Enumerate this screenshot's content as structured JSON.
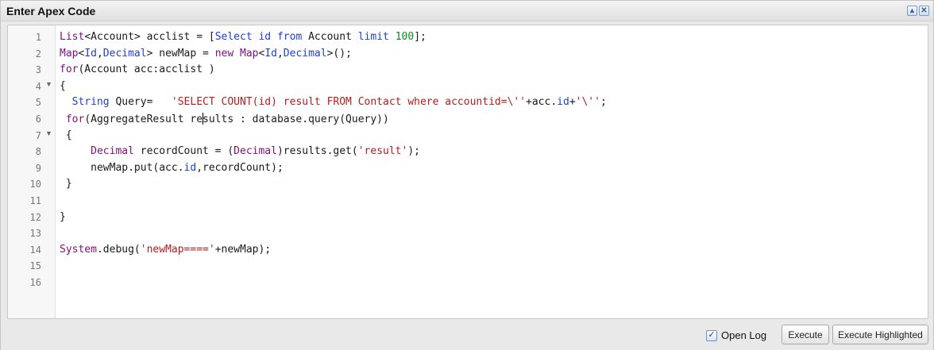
{
  "panel": {
    "title": "Enter Apex Code",
    "icons": {
      "collapse": "collapse-up-icon",
      "close": "close-icon"
    }
  },
  "editor": {
    "lines": [
      {
        "num": "1",
        "fold": "",
        "tokens": [
          {
            "t": "List",
            "k": "kw"
          },
          {
            "t": "<",
            "k": "plain"
          },
          {
            "t": "Account",
            "k": "plain"
          },
          {
            "t": "> acclist = [",
            "k": "plain"
          },
          {
            "t": "Select",
            "k": "type"
          },
          {
            "t": " ",
            "k": "plain"
          },
          {
            "t": "id",
            "k": "type"
          },
          {
            "t": " ",
            "k": "plain"
          },
          {
            "t": "from",
            "k": "type"
          },
          {
            "t": " Account ",
            "k": "plain"
          },
          {
            "t": "limit",
            "k": "type"
          },
          {
            "t": " ",
            "k": "plain"
          },
          {
            "t": "100",
            "k": "num"
          },
          {
            "t": "];",
            "k": "plain"
          }
        ]
      },
      {
        "num": "2",
        "fold": "",
        "tokens": [
          {
            "t": "Map",
            "k": "kw"
          },
          {
            "t": "<",
            "k": "plain"
          },
          {
            "t": "Id",
            "k": "type"
          },
          {
            "t": ",",
            "k": "plain"
          },
          {
            "t": "Decimal",
            "k": "type"
          },
          {
            "t": "> newMap = ",
            "k": "plain"
          },
          {
            "t": "new",
            "k": "kw"
          },
          {
            "t": " ",
            "k": "plain"
          },
          {
            "t": "Map",
            "k": "kw"
          },
          {
            "t": "<",
            "k": "plain"
          },
          {
            "t": "Id",
            "k": "type"
          },
          {
            "t": ",",
            "k": "plain"
          },
          {
            "t": "Decimal",
            "k": "type"
          },
          {
            "t": ">();",
            "k": "plain"
          }
        ]
      },
      {
        "num": "3",
        "fold": "",
        "tokens": [
          {
            "t": "for",
            "k": "kw"
          },
          {
            "t": "(Account acc:acclist )",
            "k": "plain"
          }
        ]
      },
      {
        "num": "4",
        "fold": "▼",
        "tokens": [
          {
            "t": "{",
            "k": "plain"
          }
        ]
      },
      {
        "num": "5",
        "fold": "",
        "tokens": [
          {
            "t": "  ",
            "k": "plain"
          },
          {
            "t": "String",
            "k": "type"
          },
          {
            "t": " Query=   ",
            "k": "plain"
          },
          {
            "t": "'SELECT COUNT(id) result FROM Contact where accountid=\\''",
            "k": "str"
          },
          {
            "t": "+acc.",
            "k": "plain"
          },
          {
            "t": "id",
            "k": "type"
          },
          {
            "t": "+",
            "k": "plain"
          },
          {
            "t": "'\\''",
            "k": "str"
          },
          {
            "t": ";",
            "k": "plain"
          }
        ]
      },
      {
        "num": "6",
        "fold": "",
        "tokens": [
          {
            "t": " ",
            "k": "plain"
          },
          {
            "t": "for",
            "k": "kw"
          },
          {
            "t": "(AggregateResult re",
            "k": "plain"
          },
          {
            "t": "",
            "k": "cursor"
          },
          {
            "t": "sults : database.query(Query))",
            "k": "plain"
          }
        ]
      },
      {
        "num": "7",
        "fold": "▼",
        "tokens": [
          {
            "t": " {",
            "k": "plain"
          }
        ]
      },
      {
        "num": "8",
        "fold": "",
        "tokens": [
          {
            "t": "     ",
            "k": "plain"
          },
          {
            "t": "Decimal",
            "k": "kw"
          },
          {
            "t": " recordCount = (",
            "k": "plain"
          },
          {
            "t": "Decimal",
            "k": "kw"
          },
          {
            "t": ")results.get(",
            "k": "plain"
          },
          {
            "t": "'result'",
            "k": "str"
          },
          {
            "t": ");",
            "k": "plain"
          }
        ]
      },
      {
        "num": "9",
        "fold": "",
        "tokens": [
          {
            "t": "     newMap.put(acc.",
            "k": "plain"
          },
          {
            "t": "id",
            "k": "type"
          },
          {
            "t": ",recordCount);",
            "k": "plain"
          }
        ]
      },
      {
        "num": "10",
        "fold": "",
        "tokens": [
          {
            "t": " }",
            "k": "plain"
          }
        ]
      },
      {
        "num": "11",
        "fold": "",
        "tokens": []
      },
      {
        "num": "12",
        "fold": "",
        "tokens": [
          {
            "t": "}",
            "k": "plain"
          }
        ]
      },
      {
        "num": "13",
        "fold": "",
        "tokens": []
      },
      {
        "num": "14",
        "fold": "",
        "tokens": [
          {
            "t": "System",
            "k": "kw"
          },
          {
            "t": ".debug(",
            "k": "plain"
          },
          {
            "t": "'newMap===='",
            "k": "str"
          },
          {
            "t": "+newMap);",
            "k": "plain"
          }
        ]
      },
      {
        "num": "15",
        "fold": "",
        "tokens": []
      },
      {
        "num": "16",
        "fold": "",
        "tokens": []
      }
    ]
  },
  "footer": {
    "open_log_label": "Open Log",
    "open_log_checked": true,
    "check_glyph": "✓",
    "execute_label": "Execute",
    "execute_highlighted_label": "Execute Highlighted"
  }
}
